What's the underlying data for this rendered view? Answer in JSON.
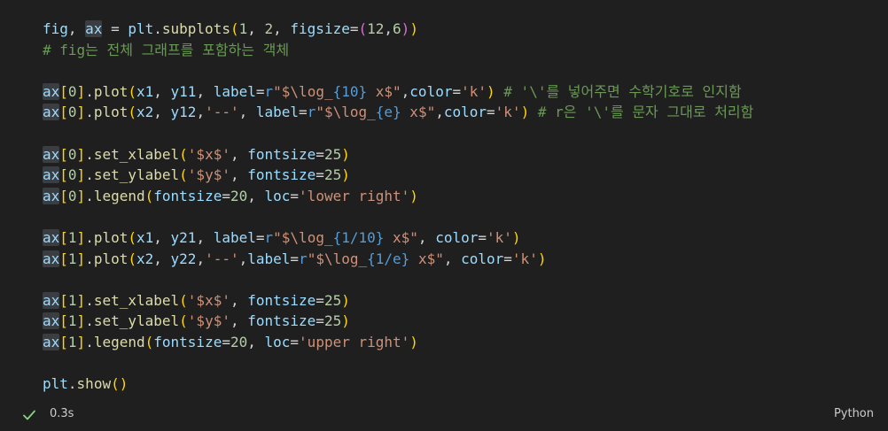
{
  "cell": {
    "lines": [
      [
        {
          "t": "fig",
          "c": "v"
        },
        {
          "t": ", ",
          "c": "p"
        },
        {
          "t": "ax",
          "c": "v hl"
        },
        {
          "t": " = ",
          "c": "p"
        },
        {
          "t": "plt",
          "c": "v"
        },
        {
          "t": ".",
          "c": "p"
        },
        {
          "t": "subplots",
          "c": "f"
        },
        {
          "t": "(",
          "c": "b1"
        },
        {
          "t": "1",
          "c": "n"
        },
        {
          "t": ", ",
          "c": "p"
        },
        {
          "t": "2",
          "c": "n"
        },
        {
          "t": ", ",
          "c": "p"
        },
        {
          "t": "figsize",
          "c": "v"
        },
        {
          "t": "=",
          "c": "p"
        },
        {
          "t": "(",
          "c": "b2"
        },
        {
          "t": "12",
          "c": "n"
        },
        {
          "t": ",",
          "c": "p"
        },
        {
          "t": "6",
          "c": "n"
        },
        {
          "t": ")",
          "c": "b2"
        },
        {
          "t": ")",
          "c": "b1"
        }
      ],
      [
        {
          "t": "# fig는 전체 그래프를 포함하는 객체",
          "c": "c"
        }
      ],
      [],
      [
        {
          "t": "ax",
          "c": "v hl"
        },
        {
          "t": "[",
          "c": "b1"
        },
        {
          "t": "0",
          "c": "n"
        },
        {
          "t": "]",
          "c": "b1"
        },
        {
          "t": ".",
          "c": "p"
        },
        {
          "t": "plot",
          "c": "f"
        },
        {
          "t": "(",
          "c": "b1"
        },
        {
          "t": "x1",
          "c": "v"
        },
        {
          "t": ", ",
          "c": "p"
        },
        {
          "t": "y11",
          "c": "v"
        },
        {
          "t": ", ",
          "c": "p"
        },
        {
          "t": "label",
          "c": "v"
        },
        {
          "t": "=",
          "c": "p"
        },
        {
          "t": "r",
          "c": "st"
        },
        {
          "t": "\"$\\log_",
          "c": "s"
        },
        {
          "t": "{10}",
          "c": "st"
        },
        {
          "t": " x$\"",
          "c": "s"
        },
        {
          "t": ",",
          "c": "p"
        },
        {
          "t": "color",
          "c": "v"
        },
        {
          "t": "=",
          "c": "p"
        },
        {
          "t": "'k'",
          "c": "s"
        },
        {
          "t": ")",
          "c": "b1"
        },
        {
          "t": " # '\\'를 넣어주면 수학기호로 인지함",
          "c": "c"
        }
      ],
      [
        {
          "t": "ax",
          "c": "v hl"
        },
        {
          "t": "[",
          "c": "b1"
        },
        {
          "t": "0",
          "c": "n"
        },
        {
          "t": "]",
          "c": "b1"
        },
        {
          "t": ".",
          "c": "p"
        },
        {
          "t": "plot",
          "c": "f"
        },
        {
          "t": "(",
          "c": "b1"
        },
        {
          "t": "x2",
          "c": "v"
        },
        {
          "t": ", ",
          "c": "p"
        },
        {
          "t": "y12",
          "c": "v"
        },
        {
          "t": ",",
          "c": "p"
        },
        {
          "t": "'--'",
          "c": "s"
        },
        {
          "t": ", ",
          "c": "p"
        },
        {
          "t": "label",
          "c": "v"
        },
        {
          "t": "=",
          "c": "p"
        },
        {
          "t": "r",
          "c": "st"
        },
        {
          "t": "\"$\\log_",
          "c": "s"
        },
        {
          "t": "{e}",
          "c": "st"
        },
        {
          "t": " x$\"",
          "c": "s"
        },
        {
          "t": ",",
          "c": "p"
        },
        {
          "t": "color",
          "c": "v"
        },
        {
          "t": "=",
          "c": "p"
        },
        {
          "t": "'k'",
          "c": "s"
        },
        {
          "t": ")",
          "c": "b1"
        },
        {
          "t": " # r은 '\\'를 문자 그대로 처리함",
          "c": "c"
        }
      ],
      [],
      [
        {
          "t": "ax",
          "c": "v hl"
        },
        {
          "t": "[",
          "c": "b1"
        },
        {
          "t": "0",
          "c": "n"
        },
        {
          "t": "]",
          "c": "b1"
        },
        {
          "t": ".",
          "c": "p"
        },
        {
          "t": "set_xlabel",
          "c": "f"
        },
        {
          "t": "(",
          "c": "b1"
        },
        {
          "t": "'$x$'",
          "c": "s"
        },
        {
          "t": ", ",
          "c": "p"
        },
        {
          "t": "fontsize",
          "c": "v"
        },
        {
          "t": "=",
          "c": "p"
        },
        {
          "t": "25",
          "c": "n"
        },
        {
          "t": ")",
          "c": "b1"
        }
      ],
      [
        {
          "t": "ax",
          "c": "v hl"
        },
        {
          "t": "[",
          "c": "b1"
        },
        {
          "t": "0",
          "c": "n"
        },
        {
          "t": "]",
          "c": "b1"
        },
        {
          "t": ".",
          "c": "p"
        },
        {
          "t": "set_ylabel",
          "c": "f"
        },
        {
          "t": "(",
          "c": "b1"
        },
        {
          "t": "'$y$'",
          "c": "s"
        },
        {
          "t": ", ",
          "c": "p"
        },
        {
          "t": "fontsize",
          "c": "v"
        },
        {
          "t": "=",
          "c": "p"
        },
        {
          "t": "25",
          "c": "n"
        },
        {
          "t": ")",
          "c": "b1"
        }
      ],
      [
        {
          "t": "ax",
          "c": "v hl"
        },
        {
          "t": "[",
          "c": "b1"
        },
        {
          "t": "0",
          "c": "n"
        },
        {
          "t": "]",
          "c": "b1"
        },
        {
          "t": ".",
          "c": "p"
        },
        {
          "t": "legend",
          "c": "f"
        },
        {
          "t": "(",
          "c": "b1"
        },
        {
          "t": "fontsize",
          "c": "v"
        },
        {
          "t": "=",
          "c": "p"
        },
        {
          "t": "20",
          "c": "n"
        },
        {
          "t": ", ",
          "c": "p"
        },
        {
          "t": "loc",
          "c": "v"
        },
        {
          "t": "=",
          "c": "p"
        },
        {
          "t": "'lower right'",
          "c": "s"
        },
        {
          "t": ")",
          "c": "b1"
        }
      ],
      [],
      [
        {
          "t": "ax",
          "c": "v hl"
        },
        {
          "t": "[",
          "c": "b1"
        },
        {
          "t": "1",
          "c": "n"
        },
        {
          "t": "]",
          "c": "b1"
        },
        {
          "t": ".",
          "c": "p"
        },
        {
          "t": "plot",
          "c": "f"
        },
        {
          "t": "(",
          "c": "b1"
        },
        {
          "t": "x1",
          "c": "v"
        },
        {
          "t": ", ",
          "c": "p"
        },
        {
          "t": "y21",
          "c": "v"
        },
        {
          "t": ", ",
          "c": "p"
        },
        {
          "t": "label",
          "c": "v"
        },
        {
          "t": "=",
          "c": "p"
        },
        {
          "t": "r",
          "c": "st"
        },
        {
          "t": "\"$\\log_",
          "c": "s"
        },
        {
          "t": "{1/10}",
          "c": "st"
        },
        {
          "t": " x$\"",
          "c": "s"
        },
        {
          "t": ", ",
          "c": "p"
        },
        {
          "t": "color",
          "c": "v"
        },
        {
          "t": "=",
          "c": "p"
        },
        {
          "t": "'k'",
          "c": "s"
        },
        {
          "t": ")",
          "c": "b1"
        }
      ],
      [
        {
          "t": "ax",
          "c": "v hl"
        },
        {
          "t": "[",
          "c": "b1"
        },
        {
          "t": "1",
          "c": "n"
        },
        {
          "t": "]",
          "c": "b1"
        },
        {
          "t": ".",
          "c": "p"
        },
        {
          "t": "plot",
          "c": "f"
        },
        {
          "t": "(",
          "c": "b1"
        },
        {
          "t": "x2",
          "c": "v"
        },
        {
          "t": ", ",
          "c": "p"
        },
        {
          "t": "y22",
          "c": "v"
        },
        {
          "t": ",",
          "c": "p"
        },
        {
          "t": "'--'",
          "c": "s"
        },
        {
          "t": ",",
          "c": "p"
        },
        {
          "t": "label",
          "c": "v"
        },
        {
          "t": "=",
          "c": "p"
        },
        {
          "t": "r",
          "c": "st"
        },
        {
          "t": "\"$\\log_",
          "c": "s"
        },
        {
          "t": "{1/e}",
          "c": "st"
        },
        {
          "t": " x$\"",
          "c": "s"
        },
        {
          "t": ", ",
          "c": "p"
        },
        {
          "t": "color",
          "c": "v"
        },
        {
          "t": "=",
          "c": "p"
        },
        {
          "t": "'k'",
          "c": "s"
        },
        {
          "t": ")",
          "c": "b1"
        }
      ],
      [],
      [
        {
          "t": "ax",
          "c": "v hl"
        },
        {
          "t": "[",
          "c": "b1"
        },
        {
          "t": "1",
          "c": "n"
        },
        {
          "t": "]",
          "c": "b1"
        },
        {
          "t": ".",
          "c": "p"
        },
        {
          "t": "set_xlabel",
          "c": "f"
        },
        {
          "t": "(",
          "c": "b1"
        },
        {
          "t": "'$x$'",
          "c": "s"
        },
        {
          "t": ", ",
          "c": "p"
        },
        {
          "t": "fontsize",
          "c": "v"
        },
        {
          "t": "=",
          "c": "p"
        },
        {
          "t": "25",
          "c": "n"
        },
        {
          "t": ")",
          "c": "b1"
        }
      ],
      [
        {
          "t": "ax",
          "c": "v hl"
        },
        {
          "t": "[",
          "c": "b1"
        },
        {
          "t": "1",
          "c": "n"
        },
        {
          "t": "]",
          "c": "b1"
        },
        {
          "t": ".",
          "c": "p"
        },
        {
          "t": "set_ylabel",
          "c": "f"
        },
        {
          "t": "(",
          "c": "b1"
        },
        {
          "t": "'$y$'",
          "c": "s"
        },
        {
          "t": ", ",
          "c": "p"
        },
        {
          "t": "fontsize",
          "c": "v"
        },
        {
          "t": "=",
          "c": "p"
        },
        {
          "t": "25",
          "c": "n"
        },
        {
          "t": ")",
          "c": "b1"
        }
      ],
      [
        {
          "t": "ax",
          "c": "v hl"
        },
        {
          "t": "[",
          "c": "b1"
        },
        {
          "t": "1",
          "c": "n"
        },
        {
          "t": "]",
          "c": "b1"
        },
        {
          "t": ".",
          "c": "p"
        },
        {
          "t": "legend",
          "c": "f"
        },
        {
          "t": "(",
          "c": "b1"
        },
        {
          "t": "fontsize",
          "c": "v"
        },
        {
          "t": "=",
          "c": "p"
        },
        {
          "t": "20",
          "c": "n"
        },
        {
          "t": ", ",
          "c": "p"
        },
        {
          "t": "loc",
          "c": "v"
        },
        {
          "t": "=",
          "c": "p"
        },
        {
          "t": "'upper right'",
          "c": "s"
        },
        {
          "t": ")",
          "c": "b1"
        }
      ],
      [],
      [
        {
          "t": "plt",
          "c": "v"
        },
        {
          "t": ".",
          "c": "p"
        },
        {
          "t": "show",
          "c": "f"
        },
        {
          "t": "(",
          "c": "b1"
        },
        {
          "t": ")",
          "c": "b1"
        }
      ]
    ]
  },
  "status": {
    "check_icon": "check-icon",
    "success_color": "#89d185",
    "exec_time": "0.3s",
    "language": "Python"
  }
}
